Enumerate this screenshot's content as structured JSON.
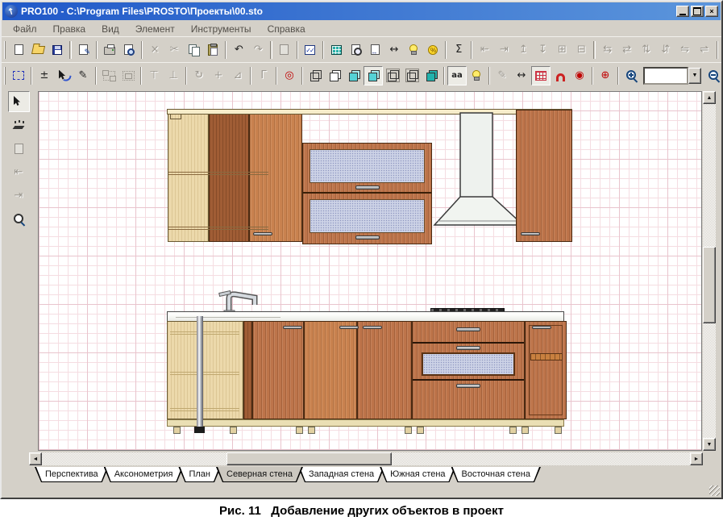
{
  "window": {
    "title": "PRO100 - C:\\Program Files\\PROSTO\\Проекты\\00.sto",
    "titlebar_gradient": [
      "#2058c8",
      "#5c96dc"
    ],
    "buttons": [
      {
        "id": "minimize",
        "shape": "bar"
      },
      {
        "id": "maximize",
        "shape": "box"
      },
      {
        "id": "close",
        "glyph": "×"
      }
    ]
  },
  "menu": {
    "items": [
      {
        "id": "file",
        "label": "Файл"
      },
      {
        "id": "edit",
        "label": "Правка"
      },
      {
        "id": "view",
        "label": "Вид"
      },
      {
        "id": "element",
        "label": "Элемент"
      },
      {
        "id": "tools",
        "label": "Инструменты"
      },
      {
        "id": "help",
        "label": "Справка"
      }
    ]
  },
  "toolbar_main": {
    "items": [
      {
        "handle": true
      },
      {
        "id": "new",
        "icon": "page"
      },
      {
        "id": "open",
        "icon": "folder"
      },
      {
        "id": "save",
        "icon": "disk"
      },
      {
        "sep": true
      },
      {
        "id": "edit-document",
        "icon": "page-edit"
      },
      {
        "sep": true
      },
      {
        "id": "print",
        "icon": "print"
      },
      {
        "id": "print-preview",
        "icon": "preview"
      },
      {
        "sep": true
      },
      {
        "id": "delete",
        "glyph": "×",
        "grayed": true
      },
      {
        "id": "cut",
        "glyph": "✂",
        "grayed": true
      },
      {
        "id": "copy",
        "icon": "copy"
      },
      {
        "id": "paste",
        "icon": "paste"
      },
      {
        "sep": true
      },
      {
        "id": "undo",
        "glyph": "↶"
      },
      {
        "id": "redo",
        "glyph": "↷",
        "grayed": true
      },
      {
        "sep": true
      },
      {
        "id": "properties",
        "icon": "page-gray",
        "grayed": true
      },
      {
        "sep": true
      },
      {
        "id": "element-check",
        "icon": "checklist"
      },
      {
        "sep": true
      },
      {
        "id": "report",
        "icon": "table-teal"
      },
      {
        "id": "find-element",
        "icon": "loupe-page"
      },
      {
        "id": "object-dimensions",
        "icon": "page-dims"
      },
      {
        "id": "measure",
        "glyph": "↔"
      },
      {
        "id": "hint-lamp",
        "icon": "bulb"
      },
      {
        "id": "price-calc",
        "icon": "coin"
      },
      {
        "sep": true
      },
      {
        "id": "summary",
        "glyph": "Σ"
      },
      {
        "sep": true
      },
      {
        "id": "align-left",
        "glyph": "⇤",
        "grayed": true
      },
      {
        "id": "align-right",
        "glyph": "⇥",
        "grayed": true
      },
      {
        "id": "align-top",
        "glyph": "↥",
        "grayed": true
      },
      {
        "id": "align-bottom",
        "glyph": "↧",
        "grayed": true
      },
      {
        "id": "center-horizontal",
        "glyph": "⊞",
        "grayed": true
      },
      {
        "id": "center-vertical",
        "glyph": "⊟",
        "grayed": true
      },
      {
        "sep": true
      },
      {
        "id": "distribute-left",
        "glyph": "⇆",
        "grayed": true
      },
      {
        "id": "distribute-right",
        "glyph": "⇄",
        "grayed": true
      },
      {
        "id": "distribute-up",
        "glyph": "⇅",
        "grayed": true
      },
      {
        "id": "distribute-down",
        "glyph": "⇵",
        "grayed": true
      },
      {
        "id": "fit-width",
        "glyph": "⇋",
        "grayed": true
      },
      {
        "id": "fit-height",
        "glyph": "⇌",
        "grayed": true
      },
      {
        "sep": true
      }
    ]
  },
  "toolbar_view": {
    "zoom_value": "",
    "combo_arrow": "▼",
    "items": [
      {
        "handle": true
      },
      {
        "id": "selection-frame",
        "icon": "marquee"
      },
      {
        "sep": true
      },
      {
        "id": "resize",
        "glyph": "±"
      },
      {
        "id": "pointer-select",
        "icon": "cursor",
        "cursor_blue": true
      },
      {
        "id": "draw",
        "glyph": "✎"
      },
      {
        "sep": true
      },
      {
        "id": "group",
        "icon": "group",
        "grayed": true
      },
      {
        "id": "ungroup",
        "icon": "ungroup",
        "grayed": true
      },
      {
        "sep": true
      },
      {
        "id": "anchor-top",
        "glyph": "⊤",
        "grayed": true
      },
      {
        "id": "anchor-bottom",
        "glyph": "⊥",
        "grayed": true
      },
      {
        "sep": true
      },
      {
        "id": "rotate",
        "glyph": "↻",
        "grayed": true
      },
      {
        "id": "move",
        "glyph": "+",
        "grayed": true
      },
      {
        "id": "mirror",
        "glyph": "⊿",
        "grayed": true
      },
      {
        "sep": true
      },
      {
        "id": "corner",
        "glyph": "Γ",
        "grayed": true
      },
      {
        "sep": true
      },
      {
        "id": "center-view",
        "glyph": "◎",
        "color": "#c00000"
      },
      {
        "sep": true
      },
      {
        "id": "view-wireframe",
        "icon": "cube",
        "cube": "cw"
      },
      {
        "id": "view-white",
        "icon": "cube",
        "cube": ""
      },
      {
        "id": "view-color",
        "icon": "cube",
        "cube": "cc"
      },
      {
        "id": "view-textures",
        "icon": "cube",
        "cube": "cc",
        "pressed": true
      },
      {
        "id": "view-outline",
        "icon": "cube",
        "cube": "cw framed"
      },
      {
        "id": "view-hidden-lines",
        "icon": "cube",
        "cube": "cw framed"
      },
      {
        "id": "view-solid",
        "icon": "cube",
        "cube": "cs"
      },
      {
        "sep": true
      },
      {
        "id": "antialias",
        "glyph": "aa",
        "small": true,
        "pressed": true
      },
      {
        "id": "lighting",
        "icon": "bulb"
      },
      {
        "sep": true
      },
      {
        "id": "sketch-mode",
        "glyph": "✎",
        "grayed": true
      },
      {
        "id": "show-dimensions",
        "glyph": "↔"
      },
      {
        "id": "show-grid",
        "icon": "grid-red",
        "pressed": true
      },
      {
        "id": "snap-magnet",
        "icon": "magnet"
      },
      {
        "id": "snap-center",
        "glyph": "◉",
        "color": "#c00000"
      },
      {
        "sep": true
      },
      {
        "id": "crosshair",
        "glyph": "⊕",
        "color": "#c00000"
      },
      {
        "sep": true
      },
      {
        "id": "zoom-in",
        "icon": "loupe-plus"
      },
      {
        "combo": true
      },
      {
        "id": "zoom-out",
        "icon": "loupe-minus"
      }
    ]
  },
  "tool_palette": {
    "items": [
      {
        "id": "pointer-tool",
        "icon": "cursor",
        "pressed": true
      },
      {
        "id": "element-insert-tool",
        "icon": "lamp"
      },
      {
        "id": "shape-tool",
        "icon": "page-gray",
        "grayed": true
      },
      {
        "id": "wall-tool",
        "glyph": "⇤",
        "grayed": true
      },
      {
        "id": "counter-tool",
        "glyph": "⇥",
        "grayed": true
      },
      {
        "id": "zoom-tool",
        "icon": "loupe-arrow"
      }
    ]
  },
  "view_tabs": {
    "tabs": [
      {
        "id": "perspective",
        "label": "Перспектива",
        "active": false
      },
      {
        "id": "axonometry",
        "label": "Аксонометрия",
        "active": false
      },
      {
        "id": "plan",
        "label": "План",
        "active": false
      },
      {
        "id": "north-wall",
        "label": "Северная стена",
        "active": true
      },
      {
        "id": "west-wall",
        "label": "Западная стена",
        "active": false
      },
      {
        "id": "south-wall",
        "label": "Южная стена",
        "active": false
      },
      {
        "id": "east-wall",
        "label": "Восточная стена",
        "active": false
      }
    ]
  },
  "scrollbars": {
    "up": "▲",
    "down": "▼",
    "left": "◄",
    "right": "►"
  },
  "canvas": {
    "grid_minor_color": "#f5dde2",
    "grid_major_color": "#e9c4cd"
  },
  "scene": {
    "description": "north wall elevation of kitchen project",
    "colors": {
      "wood": "#bd744a",
      "birch": "#ecd9ab",
      "glass": "#ccd2e6",
      "hood": "#f1f4f0",
      "countertop": "#e9ebe5"
    }
  },
  "caption": {
    "text": "Рис. 11   Добавление других объектов в проект"
  }
}
